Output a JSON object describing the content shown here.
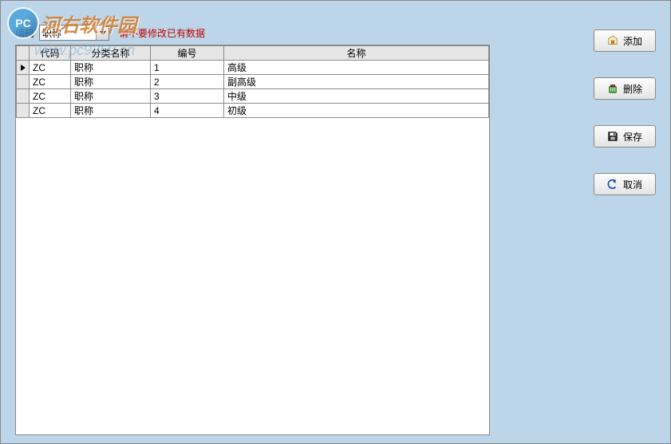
{
  "watermark": {
    "site_name": "河右软件园",
    "url": "www.pc9259.cn",
    "logo_text": "PC"
  },
  "top": {
    "label": "编码",
    "combo_value": "职称",
    "warning": "请不要修改已有数据"
  },
  "grid": {
    "headers": {
      "code": "代码",
      "category": "分类名称",
      "number": "编号",
      "name": "名称"
    },
    "rows": [
      {
        "code": "ZC",
        "category": "职称",
        "number": "1",
        "name": "高级",
        "current": true
      },
      {
        "code": "ZC",
        "category": "职称",
        "number": "2",
        "name": "副高级",
        "current": false
      },
      {
        "code": "ZC",
        "category": "职称",
        "number": "3",
        "name": "中级",
        "current": false
      },
      {
        "code": "ZC",
        "category": "职称",
        "number": "4",
        "name": "初级",
        "current": false
      }
    ]
  },
  "buttons": {
    "add": "添加",
    "delete": "删除",
    "save": "保存",
    "cancel": "取消"
  },
  "icons": {
    "add": "add-icon",
    "delete": "delete-icon",
    "save": "save-icon",
    "cancel": "cancel-icon",
    "dropdown": "chevron-down-icon"
  }
}
